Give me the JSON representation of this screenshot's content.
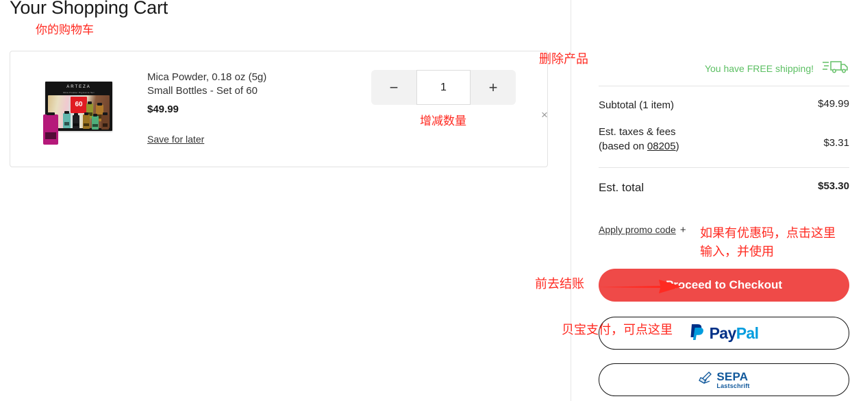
{
  "header": {
    "title": "Your Shopping Cart",
    "annotation": "你的购物车"
  },
  "cart": {
    "item": {
      "name_line1": "Mica Powder, 0.18 oz (5g)",
      "name_line2": "Small Bottles - Set of 60",
      "price": "$49.99",
      "save_for_later": "Save for later",
      "thumbnail": {
        "brand": "ARTEZA",
        "subtitle": "Mica Powder Pigments Set",
        "badge": "60",
        "badge_sub": "Colors"
      },
      "quantity": {
        "decrease_label": "−",
        "value": "1",
        "increase_label": "+"
      },
      "remove_label": "×"
    },
    "annotations": {
      "remove": "删除产品",
      "quantity": "增减数量"
    }
  },
  "summary": {
    "free_shipping_text": "You have FREE shipping!",
    "free_shipping_icon": "truck-icon",
    "rows": [
      {
        "label": "Subtotal (1 item)",
        "value": "$49.99"
      }
    ],
    "tax": {
      "label_line1": "Est. taxes & fees",
      "label_prefix": "(based on ",
      "zip": "08205",
      "label_suffix": ")",
      "value": "$3.31"
    },
    "total": {
      "label": "Est. total",
      "value": "$53.30"
    },
    "promo": {
      "label": "Apply promo code",
      "plus": "+"
    },
    "checkout_label": "Proceed to Checkout",
    "paypal": {
      "icon": "paypal-icon",
      "text_dark": "Pay",
      "text_light": "Pal"
    },
    "sepa": {
      "icon": "sepa-pen-icon",
      "main": "SEPA",
      "sub": "Lastschrift"
    },
    "annotations": {
      "promo_line1": "如果有优惠码，点击这里",
      "promo_line2": "输入，并使用",
      "checkout": "前去结账",
      "paypal": "贝宝支付，可点这里"
    }
  },
  "colors": {
    "accent_red": "#ef4a48",
    "annotation_red": "#ff2a21",
    "free_shipping_green": "#5bbf62",
    "paypal_dark": "#003087",
    "paypal_light": "#009cde",
    "sepa_blue": "#10589b"
  }
}
